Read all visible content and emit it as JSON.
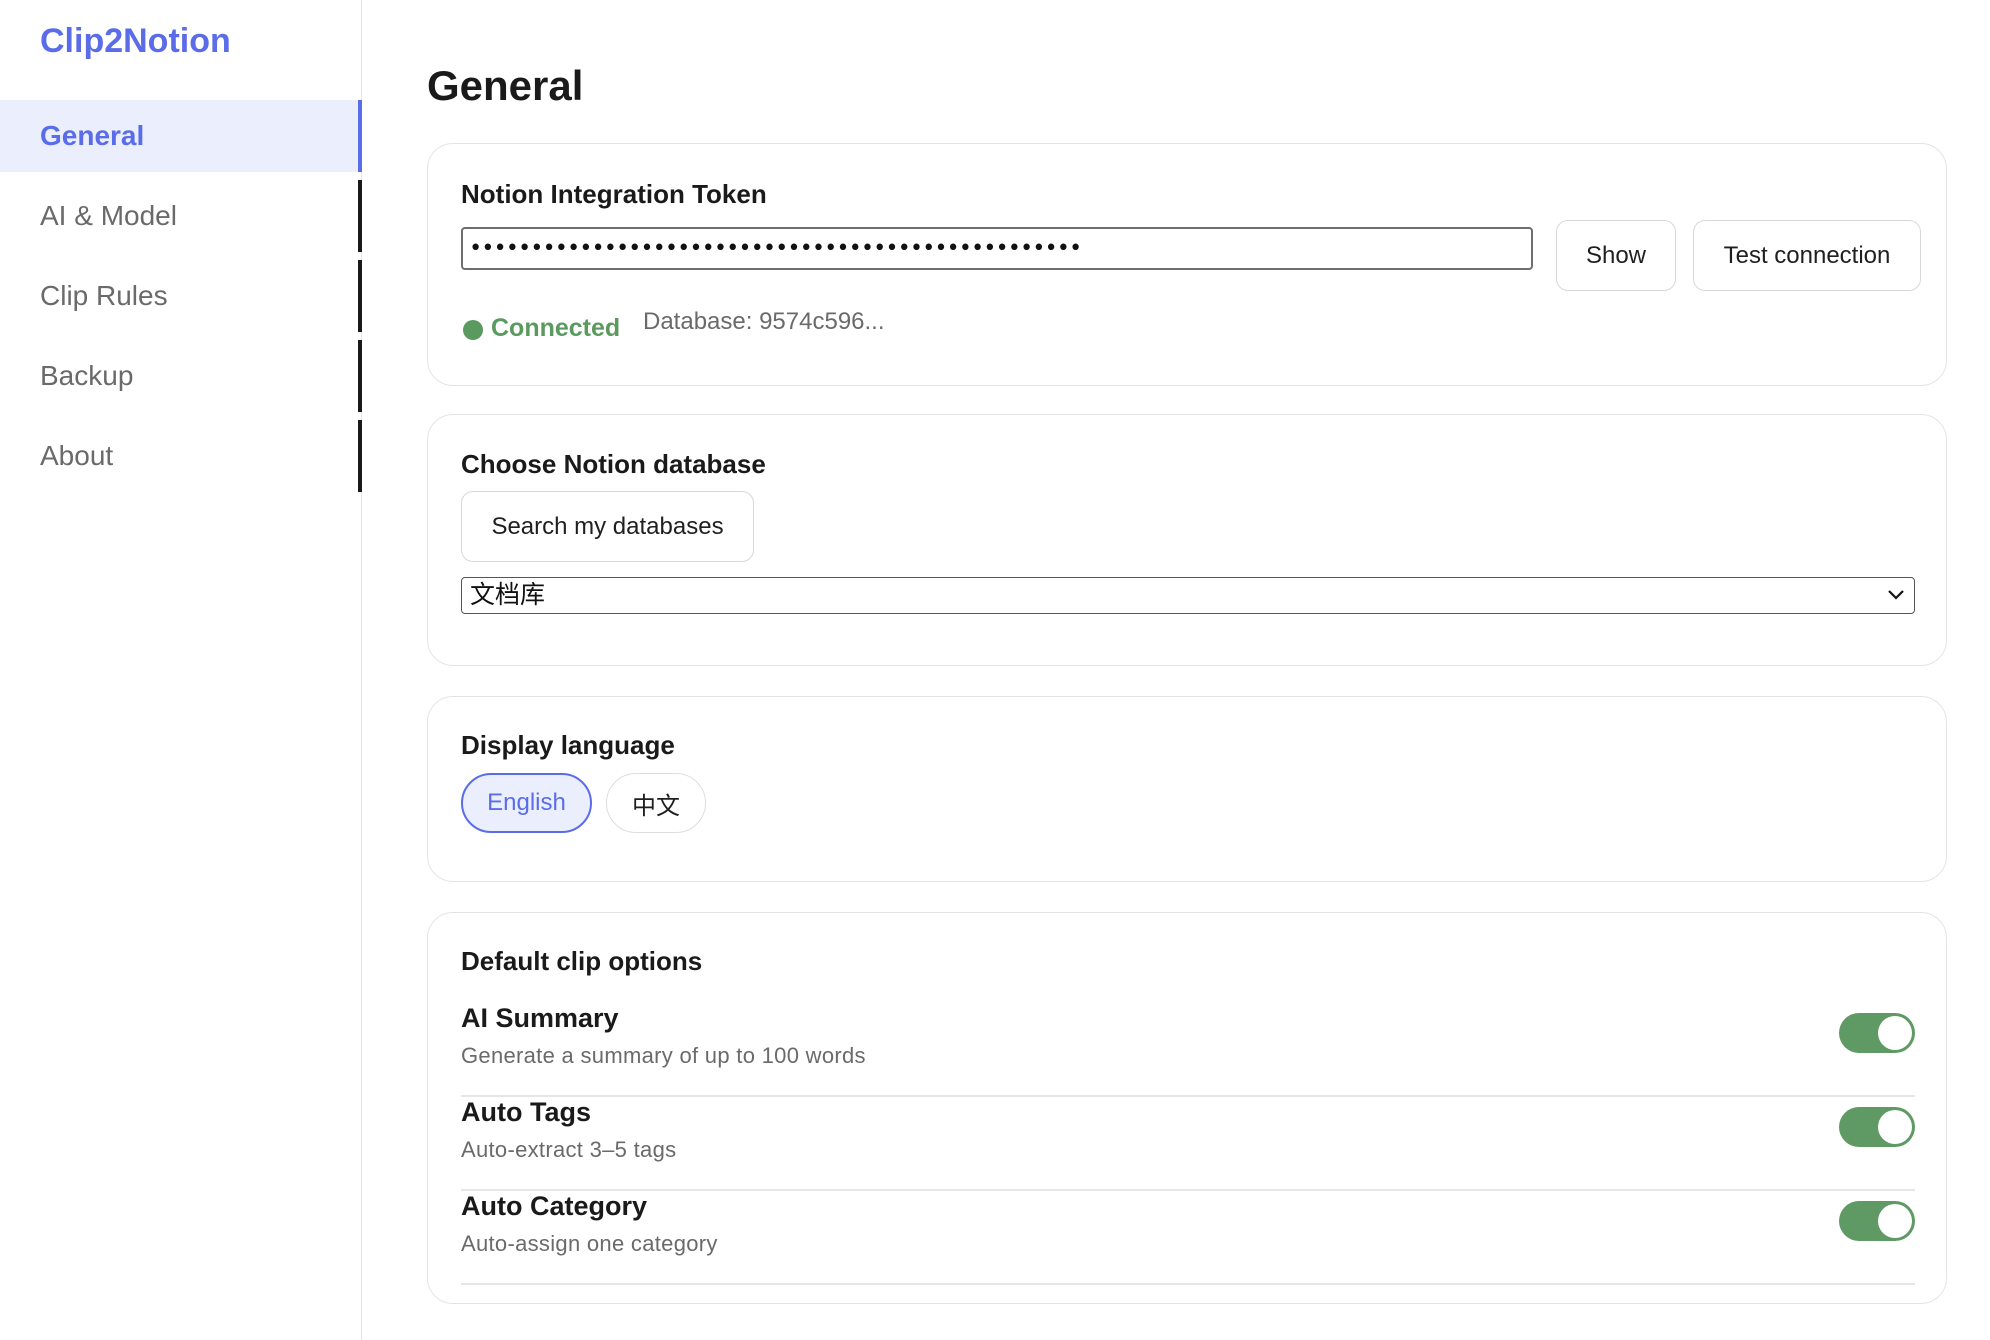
{
  "app": {
    "brand": "Clip2Notion"
  },
  "sidebar": {
    "items": [
      {
        "label": "General"
      },
      {
        "label": "AI & Model"
      },
      {
        "label": "Clip Rules"
      },
      {
        "label": "Backup"
      },
      {
        "label": "About"
      }
    ],
    "active": "General"
  },
  "main": {
    "title": "General"
  },
  "token_card": {
    "title": "Notion Integration Token",
    "token_value": "••••••••••••••••••••••••••••••••••••••••••••••••••",
    "show_label": "Show",
    "test_label": "Test connection",
    "status": "Connected",
    "database": "Database: 9574c596..."
  },
  "database_card": {
    "title": "Choose Notion database",
    "search_label": "Search my databases",
    "selected": "文档库"
  },
  "language_card": {
    "title": "Display language",
    "options": [
      "English",
      "中文"
    ],
    "selected": "English"
  },
  "clip_options": {
    "title": "Default clip options",
    "items": [
      {
        "title": "AI Summary",
        "description": "Generate a summary of up to 100 words",
        "enabled": true
      },
      {
        "title": "Auto Tags",
        "description": "Auto-extract 3–5 tags",
        "enabled": true
      },
      {
        "title": "Auto Category",
        "description": "Auto-assign one category",
        "enabled": true
      }
    ]
  },
  "colors": {
    "accent": "#5b6ce8",
    "accent_bg": "#ebeffd",
    "success": "#5a9a5f",
    "toggle_on": "#5f9a64"
  }
}
